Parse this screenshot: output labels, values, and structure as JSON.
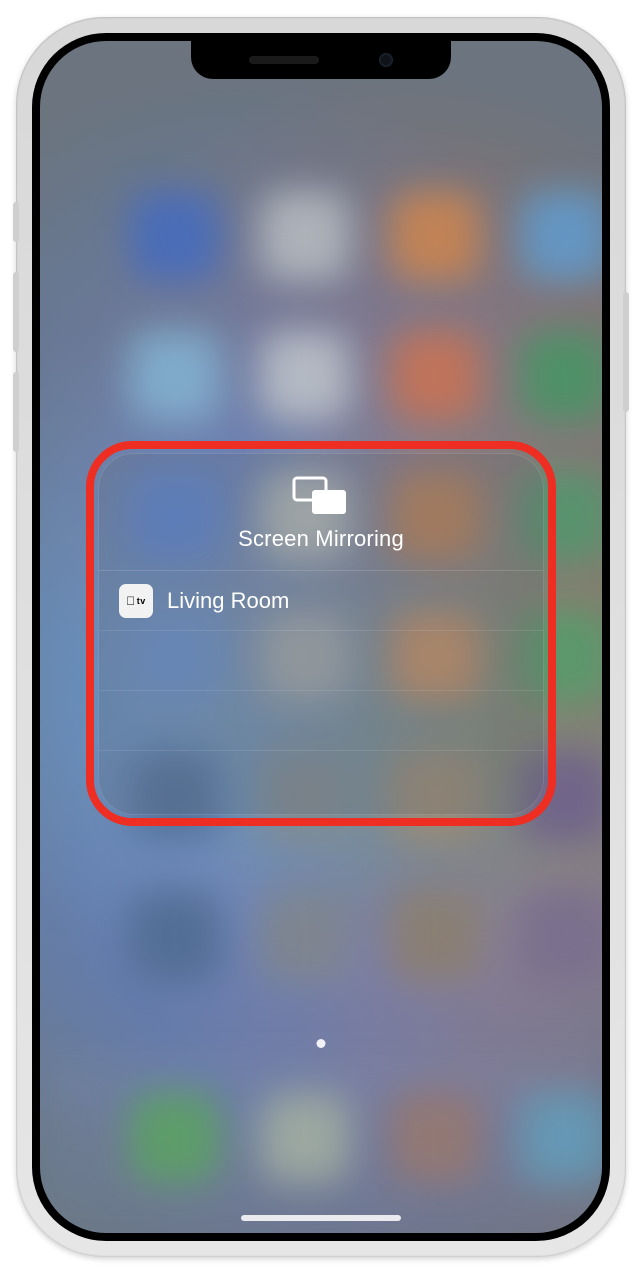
{
  "panel": {
    "title": "Screen Mirroring",
    "devices": [
      {
        "icon": "apple-tv-icon",
        "icon_label": "tv",
        "name": "Living Room"
      }
    ],
    "empty_rows": 3
  },
  "annotation": {
    "highlight_color": "#ff2a1c"
  }
}
